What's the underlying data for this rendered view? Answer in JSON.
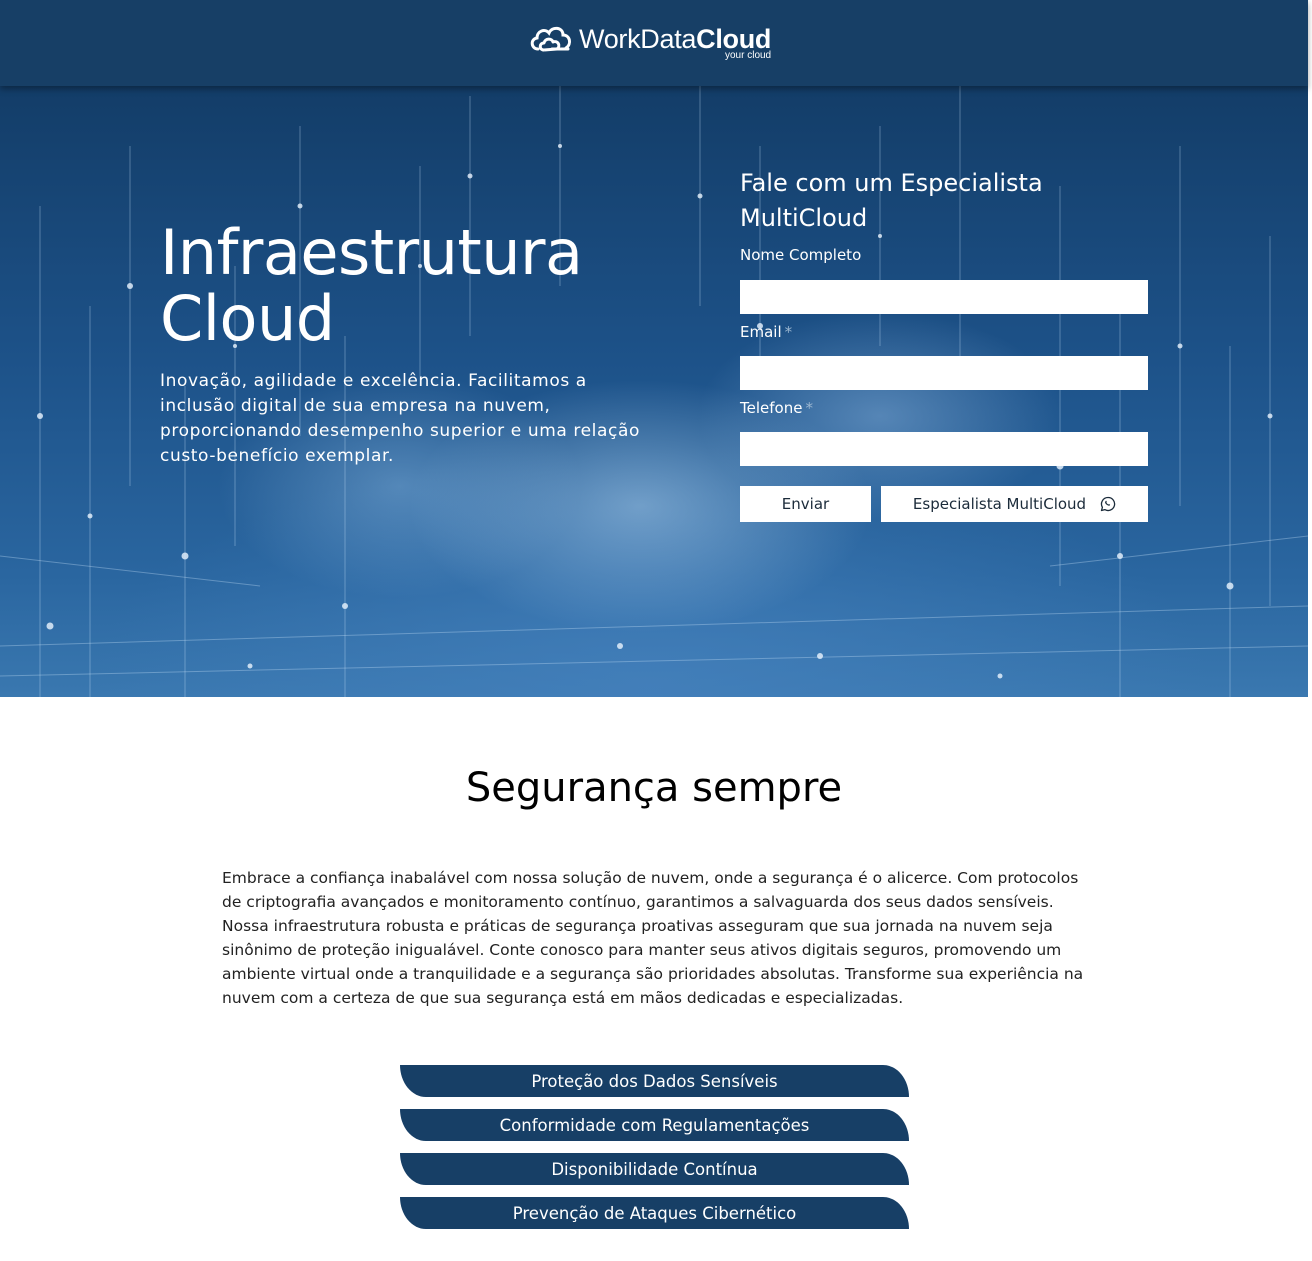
{
  "header": {
    "logo": {
      "part1": "WorkData",
      "part2": "Cloud",
      "tagline": "your cloud",
      "icon": "cloud-logo-icon"
    }
  },
  "hero": {
    "title_line1": "Infraestrutura",
    "title_line2": "Cloud",
    "description": "Inovação, agilidade e excelência. Facilitamos a inclusão digital de sua empresa na nuvem, proporcionando desempenho superior e uma relação custo-benefício exemplar."
  },
  "form": {
    "title": "Fale com um Especialista MultiCloud",
    "fields": [
      {
        "label": "Nome Completo",
        "required": false,
        "value": ""
      },
      {
        "label": "Email",
        "required": true,
        "required_mark": "*",
        "value": ""
      },
      {
        "label": "Telefone",
        "required": true,
        "required_mark": "*",
        "value": ""
      }
    ],
    "submit_label": "Enviar",
    "whatsapp_label": "Especialista MultiCloud",
    "whatsapp_icon": "whatsapp-icon"
  },
  "security": {
    "title": "Segurança sempre",
    "text": "Embrace a confiança inabalável com nossa solução de nuvem, onde a segurança é o alicerce. Com protocolos de criptografia avançados e monitoramento contínuo, garantimos a salvaguarda dos seus dados sensíveis. Nossa infraestrutura robusta e práticas de segurança proativas asseguram que sua jornada na nuvem seja sinônimo de proteção inigualável. Conte conosco para manter seus ativos digitais seguros, promovendo um ambiente virtual onde a tranquilidade e a segurança são prioridades absolutas. Transforme sua experiência na nuvem com a certeza de que sua segurança está em mãos dedicadas e especializadas.",
    "features": [
      "Proteção dos Dados Sensíveis",
      "Conformidade com Regulamentações",
      "Disponibilidade Contínua",
      "Prevenção de Ataques Cibernético"
    ]
  },
  "colors": {
    "brand_navy": "#173f66",
    "white": "#ffffff",
    "text_dark": "#222222"
  }
}
